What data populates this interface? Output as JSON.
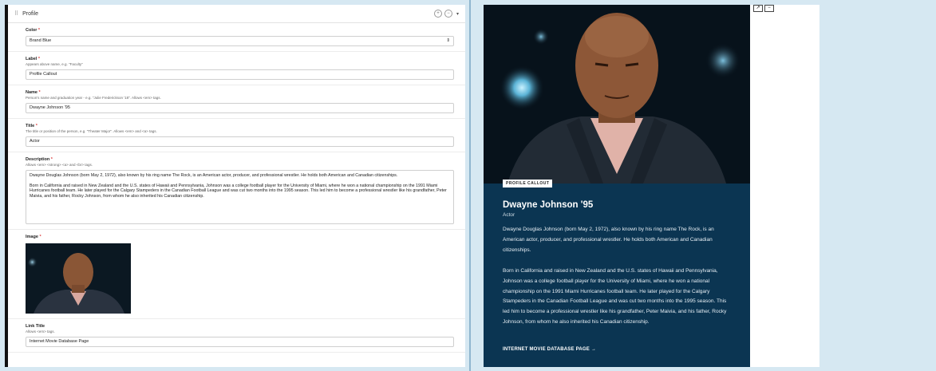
{
  "form": {
    "section_title": "Profile",
    "color": {
      "label": "Color",
      "value": "Brand Blue"
    },
    "label_field": {
      "label": "Label",
      "help": "Appears above name, e.g. \"Faculty\"",
      "value": "Profile Callout"
    },
    "name_field": {
      "label": "Name",
      "help": "Person's name and graduation year - e.g. \"Julie Frederickson '18\". Allows <em> tags.",
      "value": "Dwayne Johnson '95"
    },
    "title_field": {
      "label": "Title",
      "help": "The title or position of the person, e.g. \"Theater Major\". Allows <em> and <a> tags.",
      "value": "Actor"
    },
    "description_field": {
      "label": "Description",
      "help": "Allows <em> <strong> <a> and <br> tags.",
      "p1": "Dwayne Douglas Johnson (born May 2, 1972), also known by his ring name The Rock, is an American actor, producer, and professional wrestler. He holds both American and Canadian citizenships.",
      "p2": "Born in California and raised in New Zealand and the U.S. states of Hawaii and Pennsylvania, Johnson was a college football player for the University of Miami, where he won a national championship on the 1991 Miami Hurricanes football team. He later played for the Calgary Stampeders in the Canadian Football League and was cut two months into the 1995 season. This led him to become a professional wrestler like his grandfather, Peter Maivia, and his father, Rocky Johnson, from whom he also inherited his Canadian citizenship."
    },
    "image_field": {
      "label": "Image"
    },
    "link_title_field": {
      "label": "Link Title",
      "help": "Allows <em> tags.",
      "value": "Internet Movie Database Page"
    }
  },
  "preview": {
    "badge": "PROFILE CALLOUT",
    "name": "Dwayne Johnson '95",
    "title": "Actor",
    "p1": "Dwayne Douglas Johnson (born May 2, 1972), also known by his ring name The Rock, is an American actor, producer, and professional wrestler. He holds both American and Canadian citizenships.",
    "p2": "Born in California and raised in New Zealand and the U.S. states of Hawaii and Pennsylvania, Johnson was a college football player for the University of Miami, where he won a national championship on the 1991 Miami Hurricanes football team. He later played for the Calgary Stampeders in the Canadian Football League and was cut two months into the 1995 season. This led him to become a professional wrestler like his grandfather, Peter Maivia, and his father, Rocky Johnson, from whom he also inherited his Canadian citizenship.",
    "link": "INTERNET MOVIE DATABASE PAGE",
    "link_arrow": "→"
  },
  "colors": {
    "brand_blue": "#0b3552",
    "background": "#d6e8f2",
    "required": "#dd4444"
  }
}
